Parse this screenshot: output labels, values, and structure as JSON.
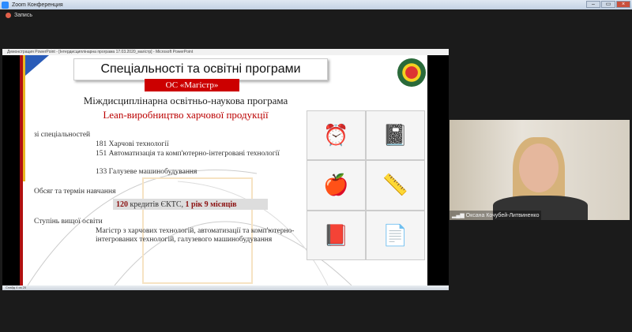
{
  "app": {
    "title": "Zoom Конференция",
    "recording": "Запись"
  },
  "ppt": {
    "window_title": "Демонстрация PowerPoint - [Інтердисциплінарна програма 17.03.2020_магістр] - Microsoft PowerPoint",
    "status": "Слайд 4 из 20"
  },
  "slide": {
    "title": "Спеціальності та освітні програми",
    "badge": "ОС «Магістр»",
    "heading1": "Міждисциплінарна освітньо-наукова програма",
    "heading2": "Lean-виробництво харчової продукції",
    "spec_label": "зі спеціальностей",
    "specialties": [
      "181 Харчові технології",
      "151 Автоматизація та комп'ютерно-інтегровані технології",
      "133 Галузеве машинобудування"
    ],
    "volume_label": "Обсяг та термін навчання",
    "credits_num": "120",
    "credits_text": " кредитів ЄКТС, ",
    "duration": "1 рік 9 місяців",
    "degree_label": "Ступінь вищої освіти",
    "degree": "Магістр з харчових технологій, автоматизації та комп'ютерно-інтегрованих технологій, галузевого машинобудування"
  },
  "video": {
    "participant": "Оксана Кочубей-Литвиненко"
  }
}
